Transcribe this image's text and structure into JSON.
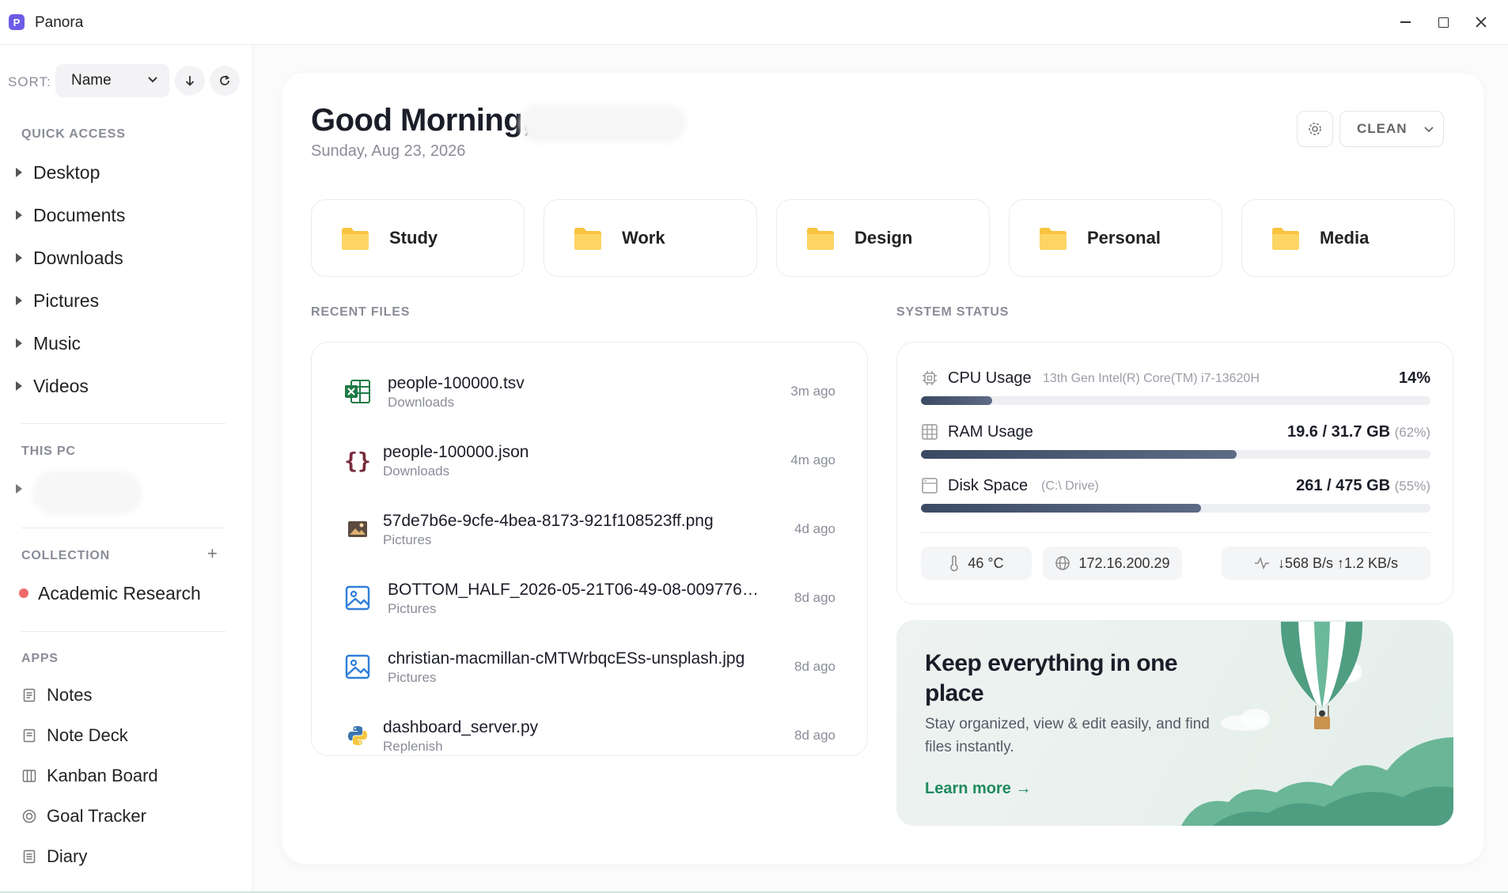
{
  "window": {
    "title": "Panora",
    "logo_letter": "P"
  },
  "sidebar": {
    "sort_label": "SORT:",
    "sort_value": "Name",
    "quick_access_title": "QUICK ACCESS",
    "quick_access": [
      {
        "label": "Desktop"
      },
      {
        "label": "Documents"
      },
      {
        "label": "Downloads"
      },
      {
        "label": "Pictures"
      },
      {
        "label": "Music"
      },
      {
        "label": "Videos"
      }
    ],
    "this_pc_title": "THIS PC",
    "collection_title": "COLLECTION",
    "collection_add": "+",
    "collections": [
      {
        "label": "Academic Research",
        "color": "#ee6a6a"
      }
    ],
    "apps_title": "APPS",
    "apps": [
      {
        "label": "Notes",
        "icon": "notes-icon"
      },
      {
        "label": "Note Deck",
        "icon": "note-deck-icon"
      },
      {
        "label": "Kanban Board",
        "icon": "kanban-icon"
      },
      {
        "label": "Goal Tracker",
        "icon": "target-icon"
      },
      {
        "label": "Diary",
        "icon": "diary-icon"
      }
    ]
  },
  "main": {
    "greeting": "Good Morning,",
    "date": "Sunday, Aug 23, 2026",
    "view_select": "CLEAN",
    "folders": [
      {
        "label": "Study"
      },
      {
        "label": "Work"
      },
      {
        "label": "Design"
      },
      {
        "label": "Personal"
      },
      {
        "label": "Media"
      }
    ],
    "recent_title": "RECENT FILES",
    "recent_files": [
      {
        "name": "people-100000.tsv",
        "location": "Downloads",
        "time": "3m ago",
        "icon": "spreadsheet-icon"
      },
      {
        "name": "people-100000.json",
        "location": "Downloads",
        "time": "4m ago",
        "icon": "json-icon"
      },
      {
        "name": "57de7b6e-9cfe-4bea-8173-921f108523ff.png",
        "location": "Pictures",
        "time": "4d ago",
        "icon": "image-thumb-icon"
      },
      {
        "name": "BOTTOM_HALF_2026-05-21T06-49-08-009776…",
        "location": "Pictures",
        "time": "8d ago",
        "icon": "image-icon"
      },
      {
        "name": "christian-macmillan-cMTWrbqcESs-unsplash.jpg",
        "location": "Pictures",
        "time": "8d ago",
        "icon": "image-icon"
      },
      {
        "name": "dashboard_server.py",
        "location": "Replenish",
        "time": "8d ago",
        "icon": "python-icon"
      }
    ],
    "status_title": "SYSTEM STATUS",
    "status": {
      "cpu": {
        "label": "CPU Usage",
        "desc": "13th Gen Intel(R) Core(TM) i7-13620H",
        "value": "14%",
        "percent": 14
      },
      "ram": {
        "label": "RAM Usage",
        "value": "19.6 / 31.7 GB",
        "pct": "(62%)",
        "percent": 62
      },
      "disk": {
        "label": "Disk Space",
        "desc": "(C:\\ Drive)",
        "value": "261 / 475 GB",
        "pct": "(55%)",
        "percent": 55
      },
      "temperature": "46 °C",
      "ip": "172.16.200.29",
      "network": "↓568 B/s  ↑1.2 KB/s"
    },
    "promo": {
      "title": "Keep everything in one place",
      "desc": "Stay organized, view & edit easily, and find files instantly.",
      "link": "Learn more →"
    }
  },
  "colors": {
    "accent": "#6c5ce7",
    "folder": "#f9c440",
    "bar": "#3b4a63",
    "link": "#1f8a5e"
  }
}
